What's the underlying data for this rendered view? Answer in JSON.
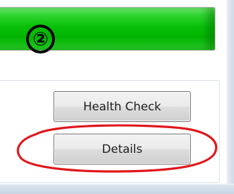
{
  "step_marker": {
    "label": "②"
  },
  "progress": {
    "value_percent": 100,
    "color": "#08c008"
  },
  "buttons": {
    "health_check_label": "Health Check",
    "details_label": "Details"
  },
  "annotation": {
    "highlight_color": "#e0161b"
  }
}
